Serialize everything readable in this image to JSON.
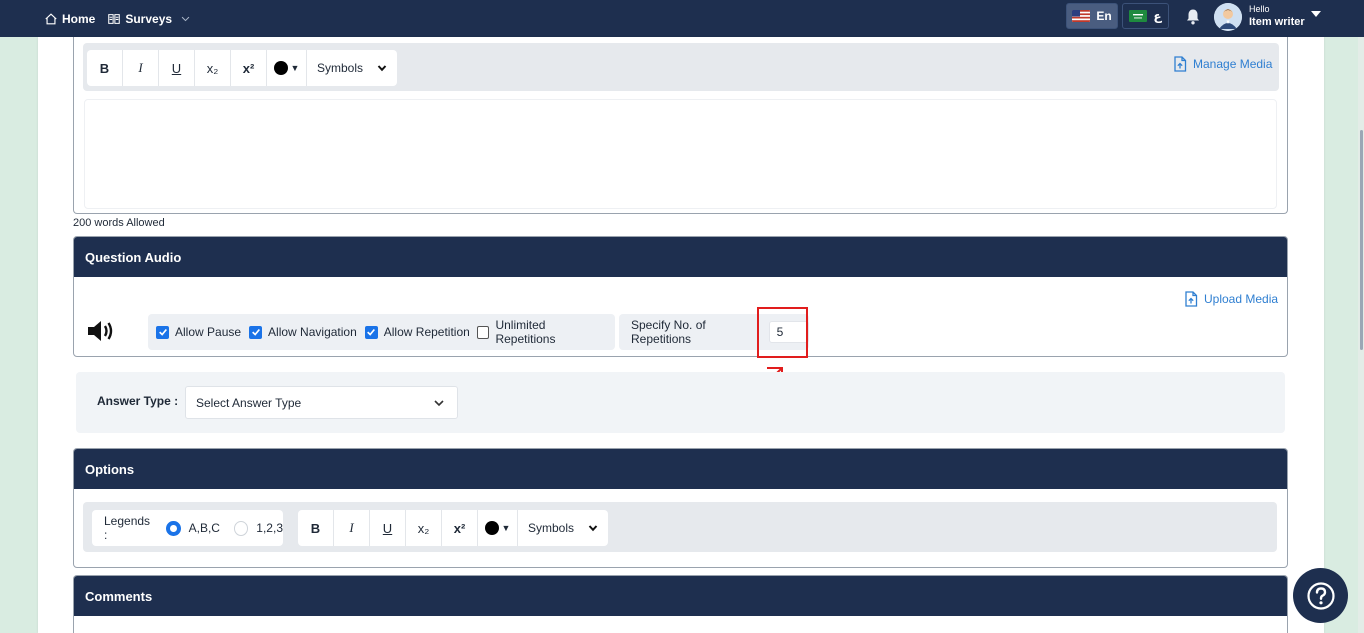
{
  "nav": {
    "home_label": "Home",
    "surveys_label": "Surveys",
    "lang_en": "En",
    "lang_ar": "ع",
    "user_hello": "Hello",
    "user_name": "Item writer"
  },
  "question_editor": {
    "toolbar": {
      "bold": "B",
      "italic": "I",
      "underline": "U",
      "subscript": "x₂",
      "superscript": "x²",
      "color_caret": "▼",
      "symbols": "Symbols"
    },
    "manage_media": "Manage Media",
    "word_limit": "200 words Allowed"
  },
  "question_audio": {
    "title": "Question Audio",
    "upload_media": "Upload Media",
    "options": [
      {
        "label": "Allow Pause",
        "checked": true
      },
      {
        "label": "Allow Navigation",
        "checked": true
      },
      {
        "label": "Allow Repetition",
        "checked": true
      }
    ],
    "unlimited": {
      "label": "Unlimited Repetitions",
      "checked": false
    },
    "repetitions_label": "Specify No. of Repetitions",
    "repetitions_value": "5"
  },
  "answer_type": {
    "label": "Answer Type :",
    "select_placeholder": "Select Answer Type"
  },
  "options_section": {
    "title": "Options",
    "legends_label": "Legends :",
    "legend_abc": "A,B,C",
    "legend_123": "1,2,3",
    "selected_legend": "A,B,C",
    "toolbar": {
      "bold": "B",
      "italic": "I",
      "underline": "U",
      "subscript": "x₂",
      "superscript": "x²",
      "color_caret": "▼",
      "symbols": "Symbols"
    }
  },
  "comments_section": {
    "title": "Comments"
  },
  "colors": {
    "navbar": "#1e2f4f",
    "accent": "#1a73e8",
    "link": "#2f7fd1",
    "annotation": "#e11d1d"
  }
}
